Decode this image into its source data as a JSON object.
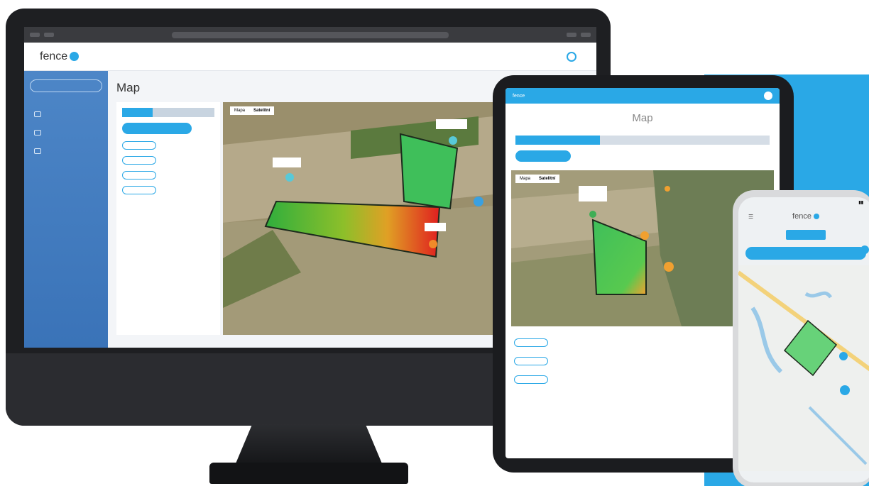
{
  "desktop": {
    "logo_text": "fence",
    "user": {
      "name": "",
      "role": ""
    },
    "sidebar": {
      "button_label": "",
      "items": [
        {
          "label": ""
        },
        {
          "label": ""
        },
        {
          "label": ""
        }
      ]
    },
    "breadcrumb": "",
    "page_title": "Map",
    "tabs": [
      "",
      "",
      ""
    ],
    "filter_button": "",
    "records": [
      {
        "title": "",
        "subtitle": "",
        "button": "",
        "link": ""
      },
      {
        "title": "",
        "subtitle": "",
        "button": "",
        "link": ""
      },
      {
        "title": "",
        "subtitle": "",
        "button": "",
        "link": ""
      },
      {
        "title": "",
        "subtitle": "",
        "button": "",
        "link": ""
      }
    ],
    "map_toggle": {
      "map": "Mapa",
      "satellite": "Satelitní"
    }
  },
  "tablet": {
    "logo_text": "fence",
    "page_title": "Map",
    "tabs": [
      "",
      "",
      ""
    ],
    "filter_button": "",
    "map_toggle": {
      "map": "Mapa",
      "satellite": "Satelitní"
    },
    "records": [
      {
        "title": "",
        "subtitle": "",
        "button": "",
        "link": ""
      },
      {
        "title": "",
        "subtitle": "",
        "button": "",
        "link": ""
      },
      {
        "title": "",
        "subtitle": "",
        "button": "",
        "link": ""
      }
    ]
  },
  "phone": {
    "time": "",
    "logo_text": "fence",
    "tabs": [
      "",
      "",
      ""
    ],
    "filter_button": "",
    "footer_link": ""
  },
  "colors": {
    "accent": "#2aa8e6",
    "sidebar": "#3f78bc",
    "danger": "#d52b2b",
    "zone_green": "#3fbf5a"
  }
}
